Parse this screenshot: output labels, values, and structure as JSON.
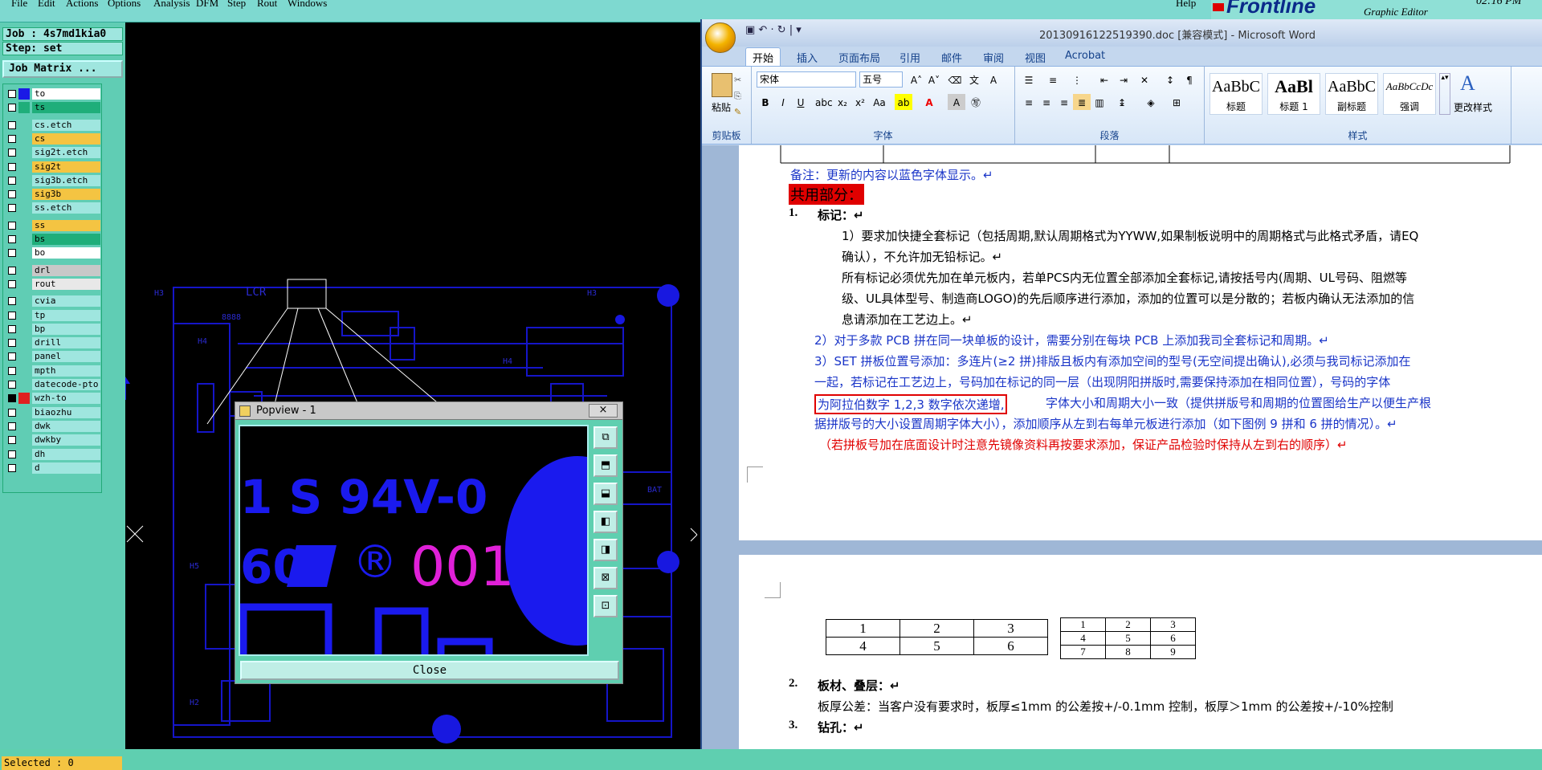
{
  "menubar": {
    "items": [
      "File",
      "Edit",
      "Actions",
      "Options",
      "Analysis",
      "DFM",
      "Step",
      "Rout",
      "Windows"
    ],
    "help": "Help"
  },
  "brand": {
    "logo_text": "Frontline",
    "graphic_editor": "Graphic Editor",
    "clock": "02:16 PM"
  },
  "left_panel": {
    "job": "Job : 4s7md1kia0",
    "step": "Step: set",
    "job_matrix": "Job Matrix ...",
    "layers": [
      {
        "name": "to",
        "color": "#ffffff",
        "swatch": "#1a1ae6"
      },
      {
        "name": "ts",
        "color": "#1fae7a",
        "swatch": "#1fae7a"
      },
      {
        "name": "cs.etch",
        "color": "#9fe6df",
        "swatch": ""
      },
      {
        "name": "cs",
        "color": "#f4c442",
        "swatch": ""
      },
      {
        "name": "sig2t.etch",
        "color": "#9fe6df",
        "swatch": ""
      },
      {
        "name": "sig2t",
        "color": "#f4c442",
        "swatch": ""
      },
      {
        "name": "sig3b.etch",
        "color": "#9fe6df",
        "swatch": ""
      },
      {
        "name": "sig3b",
        "color": "#f4c442",
        "swatch": ""
      },
      {
        "name": "ss.etch",
        "color": "#9fe6df",
        "swatch": ""
      },
      {
        "name": "ss",
        "color": "#f4c442",
        "swatch": ""
      },
      {
        "name": "bs",
        "color": "#1fae7a",
        "swatch": ""
      },
      {
        "name": "bo",
        "color": "#ffffff",
        "swatch": ""
      },
      {
        "name": "drl",
        "color": "#c8c8c8",
        "swatch": ""
      },
      {
        "name": "rout",
        "color": "#e8e8e8",
        "swatch": ""
      },
      {
        "name": "cvia",
        "color": "#9fe6df",
        "swatch": ""
      },
      {
        "name": "tp",
        "color": "#9fe6df",
        "swatch": ""
      },
      {
        "name": "bp",
        "color": "#9fe6df",
        "swatch": ""
      },
      {
        "name": "drill",
        "color": "#9fe6df",
        "swatch": ""
      },
      {
        "name": "panel",
        "color": "#9fe6df",
        "swatch": ""
      },
      {
        "name": "mpth",
        "color": "#9fe6df",
        "swatch": ""
      },
      {
        "name": "datecode-pto",
        "color": "#9fe6df",
        "swatch": ""
      },
      {
        "name": "wzh-to",
        "color": "#9fe6df",
        "swatch": "#e02020"
      },
      {
        "name": "biaozhu",
        "color": "#9fe6df",
        "swatch": ""
      },
      {
        "name": "dwk",
        "color": "#9fe6df",
        "swatch": ""
      },
      {
        "name": "dwkby",
        "color": "#9fe6df",
        "swatch": ""
      },
      {
        "name": "dh",
        "color": "#9fe6df",
        "swatch": ""
      },
      {
        "name": "d",
        "color": "#9fe6df",
        "swatch": ""
      }
    ],
    "selected": "Selected : 0"
  },
  "popview": {
    "title": "Popview - 1",
    "close_x": "×",
    "close_button": "Close",
    "preview_text_line1": "1 S 94V-0",
    "preview_text_line2": "60",
    "preview_reg": "®",
    "preview_code": "001"
  },
  "board_labels": {
    "h3a": "H3",
    "h3b": "H3",
    "h4a": "H4",
    "h4b": "H4",
    "h5": "H5",
    "h2": "H2",
    "lcr": "LCR",
    "s888": "8888",
    "bat": "BAT"
  },
  "word": {
    "title": "20130916122519390.doc [兼容模式] - Microsoft Word",
    "tabs": [
      "开始",
      "插入",
      "页面布局",
      "引用",
      "邮件",
      "审阅",
      "视图",
      "Acrobat"
    ],
    "font_name": "宋体",
    "font_size": "五号",
    "paste": "粘贴",
    "groups": {
      "clipboard": "剪贴板",
      "font": "字体",
      "paragraph": "段落",
      "styles": "样式"
    },
    "styles": [
      {
        "sample": "AaBbC",
        "label": "标题"
      },
      {
        "sample": "AaBl",
        "label": "标题 1"
      },
      {
        "sample": "AaBbC",
        "label": "副标题"
      },
      {
        "sample": "AaBbCcDc",
        "label": "强调"
      }
    ],
    "change_styles": "更改样式"
  },
  "doc": {
    "note": "备注：更新的内容以蓝色字体显示。↵",
    "common": "共用部分：",
    "s1": "1.",
    "s1_title": "标记：↵",
    "p1a": "1）要求加快捷全套标记（包括周期,默认周期格式为YYWW,如果制板说明中的周期格式与此格式矛盾，请EQ",
    "p1b": "确认），不允许加无铅标记。↵",
    "p1c": "所有标记必须优先加在单元板内，若单PCS内无位置全部添加全套标记,请按括号内(周期、UL号码、阻燃等",
    "p1d": "级、UL具体型号、制造商LOGO)的先后顺序进行添加，添加的位置可以是分散的；若板内确认无法添加的信",
    "p1e": "息请添加在工艺边上。↵",
    "p2": "2）对于多款 PCB 拼在同一块单板的设计，需要分别在每块 PCB 上添加我司全套标记和周期。↵",
    "p3a": "3）SET 拼板位置号添加：多连片(≥2 拼)排版且板内有添加空间的型号(无空间提出确认),必须与我司标记添加在",
    "p3b": "一起，若标记在工艺边上，号码加在标记的同一层（出现阴阳拼版时,需要保持添加在相同位置），号码的字体",
    "p3c_box": "为阿拉伯数字 1,2,3 数字依次递增,",
    "p3c": "字体大小和周期大小一致（提供拼版号和周期的位置图给生产以便生产根",
    "p3d": "据拼版号的大小设置周期字体大小），添加顺序从左到右每单元板进行添加（如下图例 9 拼和 6 拼的情况）。↵",
    "p3e": "（若拼板号加在底面设计时注意先镜像资料再按要求添加，保证产品检验时保持从左到右的顺序）↵",
    "table6": [
      [
        "1",
        "2",
        "3"
      ],
      [
        "4",
        "5",
        "6"
      ]
    ],
    "table9": [
      [
        "1",
        "2",
        "3"
      ],
      [
        "4",
        "5",
        "6"
      ],
      [
        "7",
        "8",
        "9"
      ]
    ],
    "s2": "2.",
    "s2_title": "板材、叠层：↵",
    "p4": "板厚公差：当客户没有要求时，板厚≤1mm 的公差按+/-0.1mm 控制，板厚＞1mm 的公差按+/-10%控制",
    "s3": "3.",
    "s3_title": "钻孔：↵"
  }
}
